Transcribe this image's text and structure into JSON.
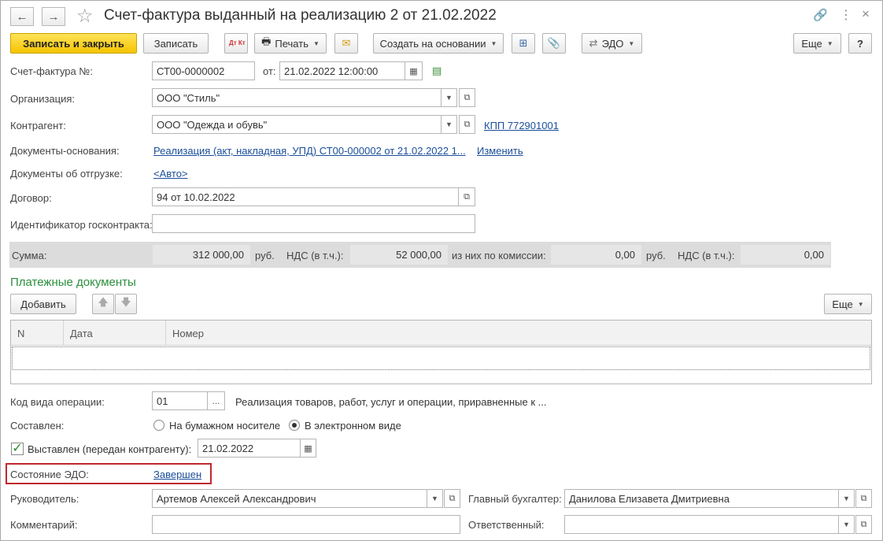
{
  "window": {
    "title": "Счет-фактура выданный на реализацию 2 от 21.02.2022",
    "back_icon": "←",
    "forward_icon": "→"
  },
  "toolbar": {
    "save_close": "Записать и закрыть",
    "save": "Записать",
    "dt_kt": "Дт Кт",
    "print": "Печать",
    "create_based": "Создать на основании",
    "edo": "ЭДО",
    "more": "Еще",
    "help": "?"
  },
  "form": {
    "invoice_no_label": "Счет-фактура №:",
    "invoice_no": "СТ00-0000002",
    "date_from_label": "от:",
    "date_from": "21.02.2022 12:00:00",
    "org_label": "Организация:",
    "org": "ООО \"Стиль\"",
    "contractor_label": "Контрагент:",
    "contractor": "ООО \"Одежда и обувь\"",
    "kpp_link": "КПП 772901001",
    "base_docs_label": "Документы-основания:",
    "base_docs_link": "Реализация (акт, накладная, УПД) СТ00-000002 от 21.02.2022 1...",
    "change_link": "Изменить",
    "shipment_docs_label": "Документы об отгрузке:",
    "shipment_docs_link": "<Авто>",
    "contract_label": "Договор:",
    "contract": "94 от 10.02.2022",
    "gov_contract_label": "Идентификатор госконтракта:",
    "gov_contract": ""
  },
  "summary": {
    "sum_label": "Сумма:",
    "sum": "312 000,00",
    "rub1": "руб.",
    "vat_label": "НДС (в т.ч.):",
    "vat": "52 000,00",
    "commission_label": "из них по комиссии:",
    "commission": "0,00",
    "rub2": "руб.",
    "vat2_label": "НДС (в т.ч.):",
    "vat2": "0,00"
  },
  "payments": {
    "title": "Платежные документы",
    "add": "Добавить",
    "more": "Еще",
    "columns": [
      "N",
      "Дата",
      "Номер"
    ]
  },
  "bottom": {
    "op_code_label": "Код вида операции:",
    "op_code": "01",
    "op_code_btn": "...",
    "op_code_desc": "Реализация товаров, работ, услуг и операции, приравненные к ...",
    "composed_label": "Составлен:",
    "paper": "На бумажном носителе",
    "electronic": "В электронном виде",
    "issued_label": "Выставлен (передан контрагенту):",
    "issued_date": "21.02.2022",
    "edo_state_label": "Состояние ЭДО:",
    "edo_state_link": "Завершен",
    "head_label": "Руководитель:",
    "head": "Артемов Алексей Александрович",
    "chief_acc_label": "Главный бухгалтер:",
    "chief_acc": "Данилова Елизавета Дмитриевна",
    "comment_label": "Комментарий:",
    "comment": "",
    "responsible_label": "Ответственный:",
    "responsible": ""
  }
}
